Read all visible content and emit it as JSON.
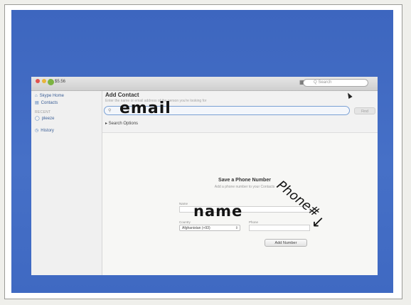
{
  "window": {
    "credit": "$5.56",
    "search_placeholder": "Q Search"
  },
  "sidebar": {
    "items": [
      {
        "label": "Skype Home",
        "icon": "home-icon"
      },
      {
        "label": "Contacts",
        "icon": "contacts-icon"
      }
    ],
    "recent_header": "RECENT",
    "recent_items": [
      {
        "label": "pleeze",
        "icon": "chat-icon"
      },
      {
        "label": "History",
        "icon": "clock-icon"
      }
    ]
  },
  "add_contact": {
    "title": "Add Contact",
    "subtitle": "Enter the name or email address of the person you're looking for",
    "search_icon": "search-icon",
    "find_button": "Find",
    "search_options": "▸  Search Options"
  },
  "save_phone": {
    "title": "Save a Phone Number",
    "subtitle": "Add a phone number to your Contacts",
    "name_label": "Name",
    "country_label": "Country",
    "phone_label": "Phone",
    "country_value": "Afghanistan (+93)",
    "add_button": "Add Number"
  },
  "annotations": {
    "email": "email",
    "name": "name",
    "phone": "Phone#",
    "arrow": "↙"
  },
  "colors": {
    "background_blue": "#4670c7",
    "search_field_border": "#7aa0d4",
    "sidebar_text": "#3c5f96"
  }
}
